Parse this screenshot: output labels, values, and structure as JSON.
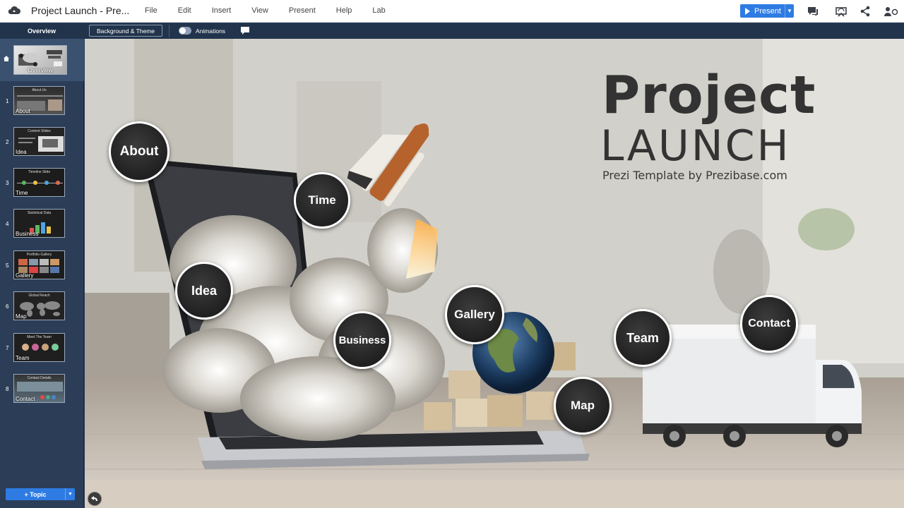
{
  "app": {
    "doc_title": "Project Launch - Pre...",
    "menu": [
      "File",
      "Edit",
      "Insert",
      "View",
      "Present",
      "Help",
      "Lab"
    ],
    "present_label": "Present",
    "present_dropdown": "▼"
  },
  "subbar": {
    "overview_label": "Overview",
    "background_theme": "Background & Theme",
    "animations_label": "Animations"
  },
  "sidebar": {
    "overview": {
      "label": "Overview"
    },
    "slides": [
      {
        "num": "1",
        "label": "About",
        "title": "About Us"
      },
      {
        "num": "2",
        "label": "Idea",
        "title": "Content Slides"
      },
      {
        "num": "3",
        "label": "Time",
        "title": "Timeline Slide"
      },
      {
        "num": "4",
        "label": "Business",
        "title": "Statistical Data"
      },
      {
        "num": "5",
        "label": "Gallery",
        "title": "Portfolio Gallery"
      },
      {
        "num": "6",
        "label": "Map",
        "title": "Global Reach"
      },
      {
        "num": "7",
        "label": "Team",
        "title": "Meet The Team"
      },
      {
        "num": "8",
        "label": "Contact",
        "title": "Contact Details"
      }
    ],
    "topic_button": "+ Topic",
    "topic_dropdown": "▼"
  },
  "canvas": {
    "title_line1": "Project",
    "title_line2": "LAUNCH",
    "subtitle": "Prezi Template by Prezibase.com",
    "bubbles": {
      "about": "About",
      "time": "Time",
      "idea": "Idea",
      "business": "Business",
      "gallery": "Gallery",
      "map": "Map",
      "team": "Team",
      "contact": "Contact"
    }
  },
  "colors": {
    "accent": "#2e7be4",
    "sidebar_bg": "#2c3e57",
    "bubble_fill": "#1f1f1f"
  },
  "icons": [
    "cloud-logo-icon",
    "comment-icon",
    "broadcast-icon",
    "share-icon",
    "collaborators-icon",
    "home-icon",
    "back-icon"
  ]
}
